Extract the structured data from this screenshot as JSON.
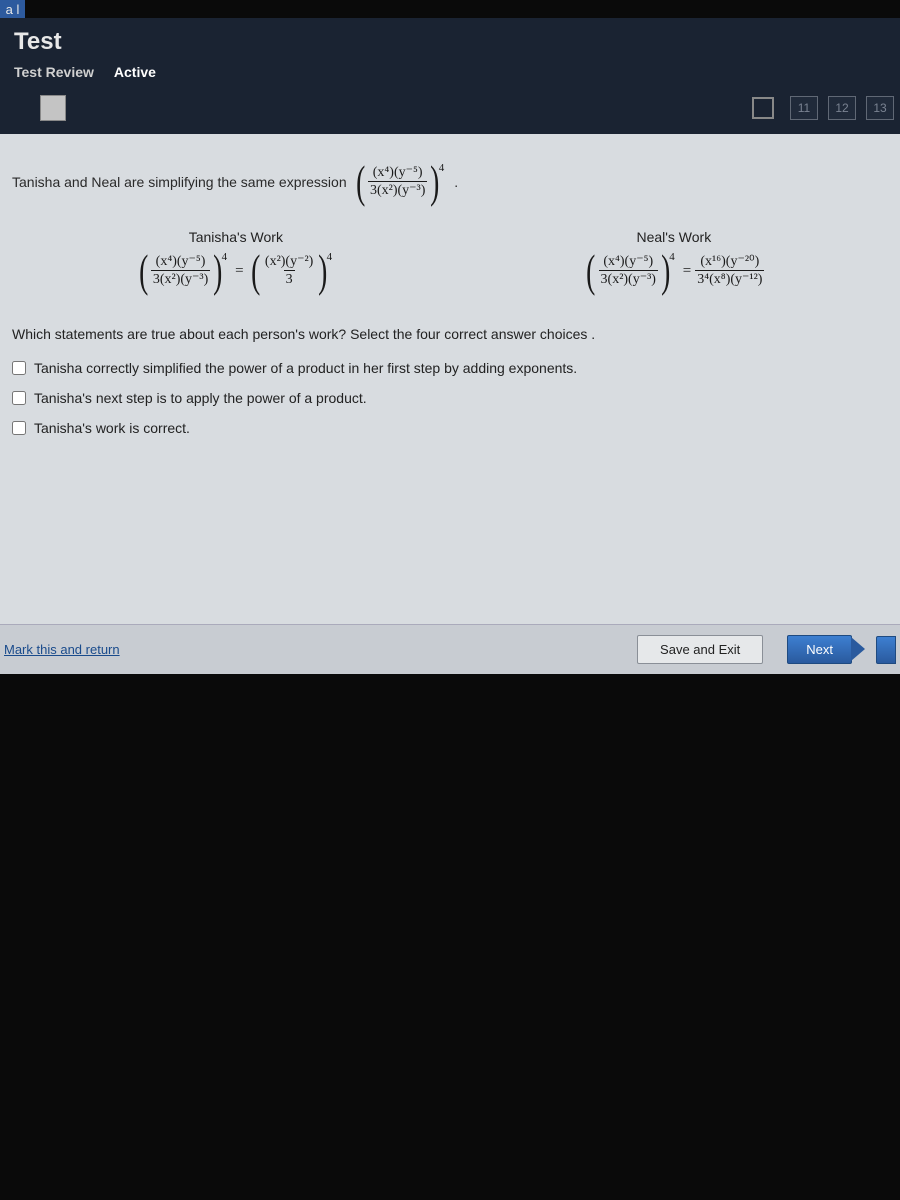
{
  "partial_tag": "a l",
  "header": {
    "title": "Test",
    "subtitle_left": "Test Review",
    "subtitle_right": "Active"
  },
  "nav": {
    "pages": [
      "11",
      "12",
      "13"
    ]
  },
  "prompt": {
    "lead": "Tanisha and Neal are simplifying the same expression",
    "expr_num": "(x⁴)(y⁻⁵)",
    "expr_den": "3(x²)(y⁻³)",
    "expr_outer_exp": "4",
    "period": "."
  },
  "tanisha": {
    "title": "Tanisha's Work",
    "lhs_num": "(x⁴)(y⁻⁵)",
    "lhs_den": "3(x²)(y⁻³)",
    "lhs_exp": "4",
    "eq": "=",
    "rhs_num": "(x²)(y⁻²)",
    "rhs_den": "3",
    "rhs_exp": "4"
  },
  "neal": {
    "title": "Neal's Work",
    "lhs_num": "(x⁴)(y⁻⁵)",
    "lhs_den": "3(x²)(y⁻³)",
    "lhs_exp": "4",
    "eq": "=",
    "rhs_num": "(x¹⁶)(y⁻²⁰)",
    "rhs_den": "3⁴(x⁸)(y⁻¹²)"
  },
  "question": "Which statements are true about each person's work? Select the four correct answer choices .",
  "options": [
    "Tanisha correctly simplified the power of a product in her first step by adding exponents.",
    "Tanisha's next step is to apply the power of a product.",
    "Tanisha's work is correct."
  ],
  "footer": {
    "mark": "Mark this and return",
    "save": "Save and Exit",
    "next": "Next"
  }
}
